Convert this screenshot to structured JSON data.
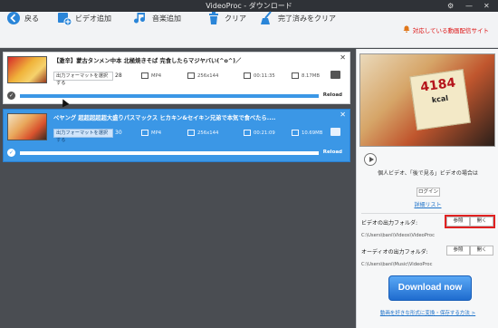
{
  "window": {
    "title": "VideoProc - ダウンロード",
    "controls": [
      "⚙",
      "—",
      "✕"
    ]
  },
  "toolbar": {
    "back": "戻る",
    "add_video": "ビデオ追加",
    "add_music": "音楽追加",
    "clear": "クリア",
    "clear_done": "完了済みをクリア",
    "notice": "対応している動画配信サイト"
  },
  "items": [
    {
      "title": "【激辛】蒙古タンメン中本 北極焼きそば 完食したらマジヤバい(^o^)／",
      "format_label": "出力フォーマットを選択する",
      "format_count": "28",
      "container": "MP4",
      "resolution": "256x144",
      "duration": "00:11:35",
      "size": "8.17MB",
      "reload": "Reload",
      "progress": 1.0
    },
    {
      "title": "ペヤング 超超超超超大盛りパスマックス ヒカキン&セイキン兄弟で本気で食べたら....",
      "format_label": "出力フォーマットを選択する",
      "format_count": "30",
      "container": "MP4",
      "resolution": "256x144",
      "duration": "00:21:09",
      "size": "10.69MB",
      "reload": "Reload",
      "progress": 1.0
    }
  ],
  "preview": {
    "sign_text": "4184",
    "sign_unit": "kcal"
  },
  "panel": {
    "info_line": "個人ビデオ、「後で見る」ビデオの場合は",
    "login": "ログイン",
    "detail_link": "詳細リスト",
    "video_folder_label": "ビデオの出力フォルダ:",
    "video_folder_path": "C:\\Users\\bani\\Videos\\VideoProc",
    "audio_folder_label": "オーディオの出力フォルダ:",
    "audio_folder_path": "C:\\Users\\bani\\Music\\VideoProc",
    "browse": "参照",
    "open": "開く",
    "download_now": "Download now",
    "footer_link": "動画を好きな形式に変換・保存する方法 >"
  }
}
